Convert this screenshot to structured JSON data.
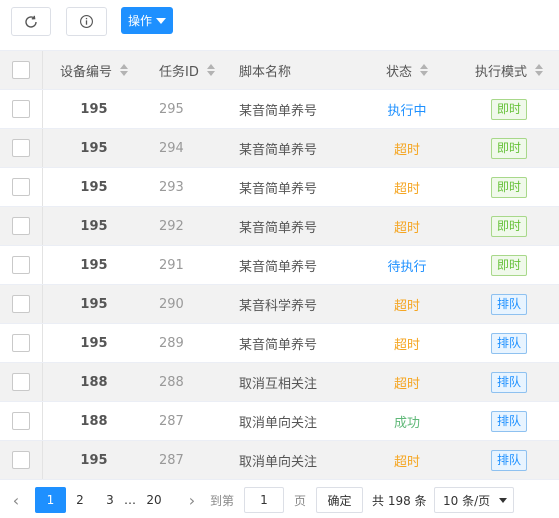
{
  "toolbar": {
    "action_label": "操作",
    "icons": {
      "refresh": "refresh-icon",
      "info": "info-icon"
    }
  },
  "table": {
    "headers": {
      "device": "设备编号",
      "task": "任务ID",
      "script": "脚本名称",
      "status": "状态",
      "mode": "执行模式"
    },
    "rows": [
      {
        "device": "195",
        "task": "295",
        "script": "某音简单养号",
        "status": "执行中",
        "status_color": "#1e90ff",
        "mode": "即时",
        "mode_kind": "green"
      },
      {
        "device": "195",
        "task": "294",
        "script": "某音简单养号",
        "status": "超时",
        "status_color": "#f5a623",
        "mode": "即时",
        "mode_kind": "green"
      },
      {
        "device": "195",
        "task": "293",
        "script": "某音简单养号",
        "status": "超时",
        "status_color": "#f5a623",
        "mode": "即时",
        "mode_kind": "green"
      },
      {
        "device": "195",
        "task": "292",
        "script": "某音简单养号",
        "status": "超时",
        "status_color": "#f5a623",
        "mode": "即时",
        "mode_kind": "green"
      },
      {
        "device": "195",
        "task": "291",
        "script": "某音简单养号",
        "status": "待执行",
        "status_color": "#1e90ff",
        "mode": "即时",
        "mode_kind": "green"
      },
      {
        "device": "195",
        "task": "290",
        "script": "某音科学养号",
        "status": "超时",
        "status_color": "#f5a623",
        "mode": "排队",
        "mode_kind": "blue"
      },
      {
        "device": "195",
        "task": "289",
        "script": "某音简单养号",
        "status": "超时",
        "status_color": "#f5a623",
        "mode": "排队",
        "mode_kind": "blue"
      },
      {
        "device": "188",
        "task": "288",
        "script": "取消互相关注",
        "status": "超时",
        "status_color": "#f5a623",
        "mode": "排队",
        "mode_kind": "blue"
      },
      {
        "device": "188",
        "task": "287",
        "script": "取消单向关注",
        "status": "成功",
        "status_color": "#5fb878",
        "mode": "排队",
        "mode_kind": "blue"
      },
      {
        "device": "195",
        "task": "287",
        "script": "取消单向关注",
        "status": "超时",
        "status_color": "#f5a623",
        "mode": "排队",
        "mode_kind": "blue"
      }
    ]
  },
  "pagination": {
    "pages": [
      "1",
      "2",
      "3"
    ],
    "ellipsis": "…",
    "last_page": "20",
    "goto_label": "到第",
    "goto_value": "1",
    "page_unit": "页",
    "confirm_label": "确定",
    "total_label": "共 198 条",
    "page_size": "10 条/页"
  }
}
